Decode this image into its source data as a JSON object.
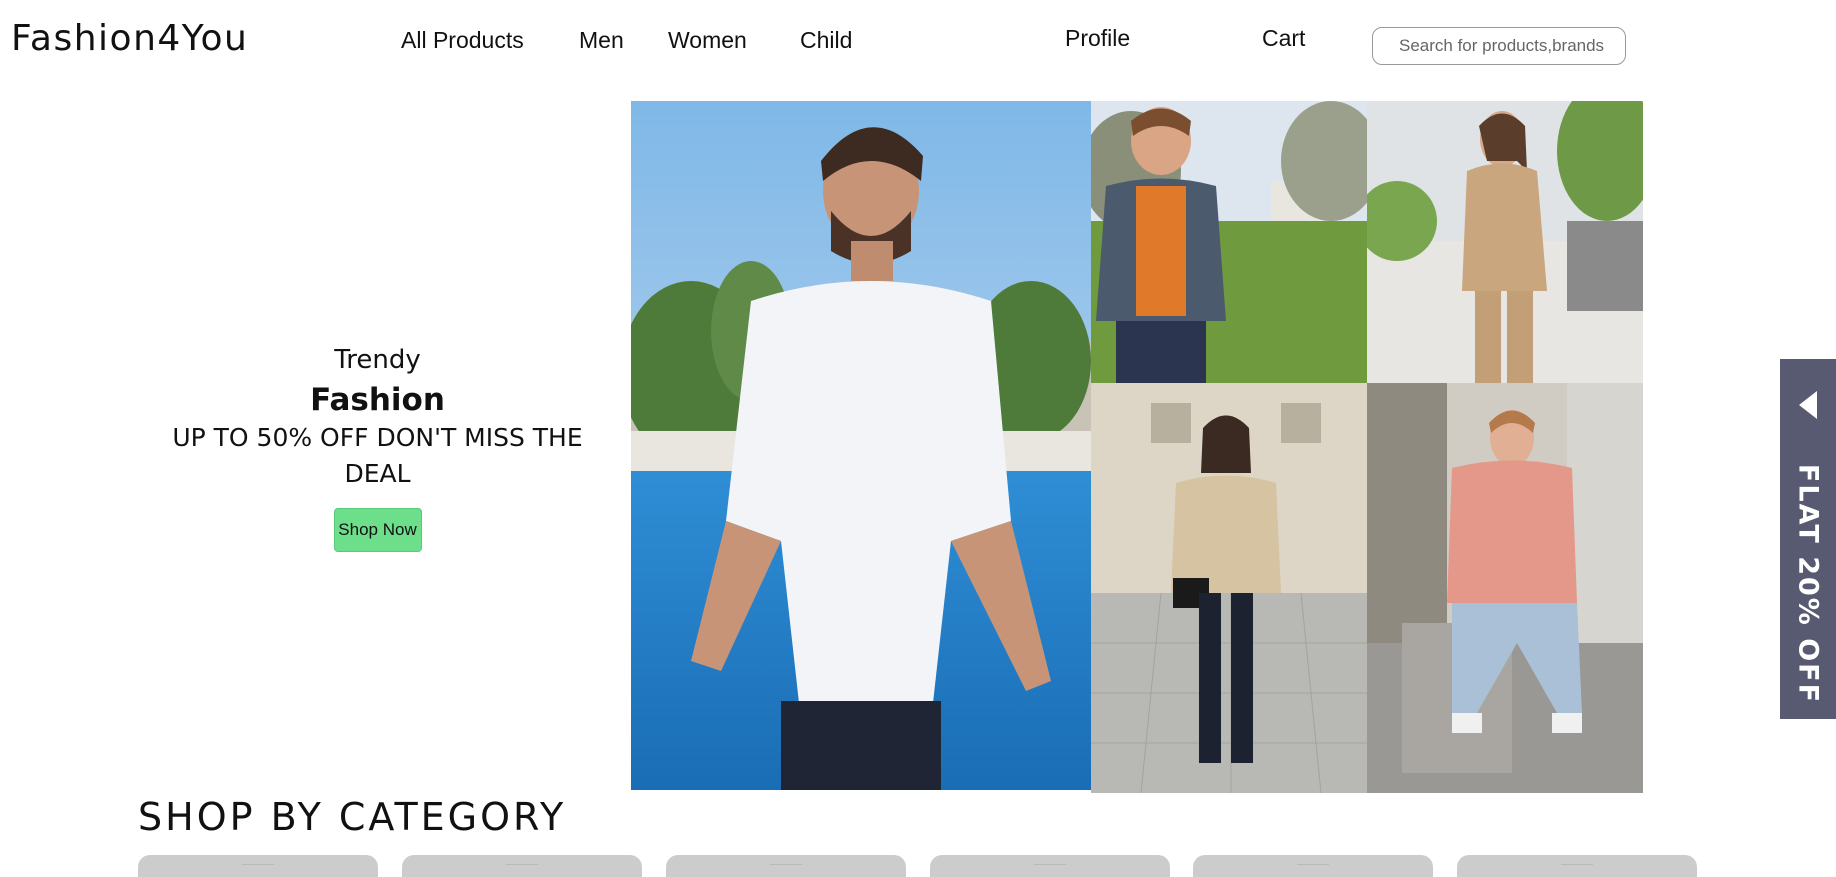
{
  "header": {
    "logo": "Fashion4You",
    "nav": [
      "All Products",
      "Men",
      "Women",
      "Child"
    ],
    "profile_label": "Profile",
    "cart_label": "Cart",
    "search_placeholder": "Search for products,brands"
  },
  "hero": {
    "line1": "Trendy",
    "line2": "Fashion",
    "line3": "UP TO 50% OFF DON'T MISS THE DEAL",
    "button_label": "Shop Now"
  },
  "side_banner": {
    "label": "FLAT 20% OFF"
  },
  "categories": {
    "title": "SHOP BY CATEGORY",
    "card_count": 6
  },
  "colors": {
    "accent_button": "#6ddf8a",
    "side_banner_bg": "#575a70",
    "card_bg": "#cccccc"
  }
}
